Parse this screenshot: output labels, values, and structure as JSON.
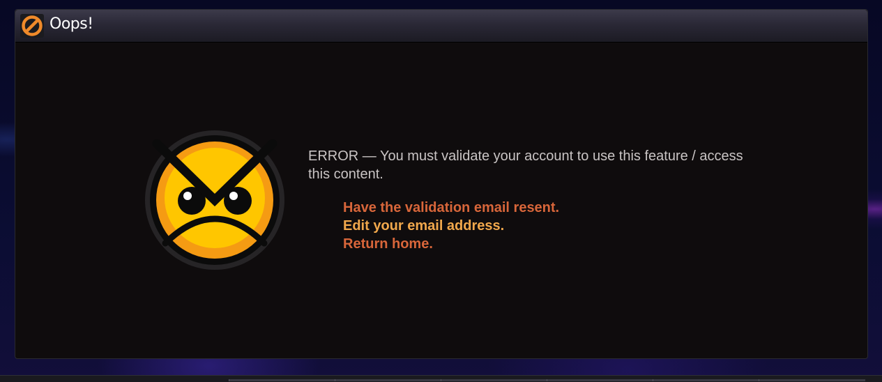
{
  "window": {
    "title": "Oops!",
    "title_icon": "no-entry-icon"
  },
  "error": {
    "message": "ERROR — You must validate your account to use this feature / access this content.",
    "illustration": "angry-face-icon"
  },
  "links": [
    {
      "label": "Have the validation email resent.",
      "color": "#d8663a"
    },
    {
      "label": "Edit your email address.",
      "color": "#f1a84c"
    },
    {
      "label": "Return home.",
      "color": "#d8663a"
    }
  ],
  "colors": {
    "accent_orange": "#d8663a",
    "accent_yellow": "#f1a84c",
    "panel_bg": "#0f0c0d",
    "text": "#c9c4c4"
  }
}
